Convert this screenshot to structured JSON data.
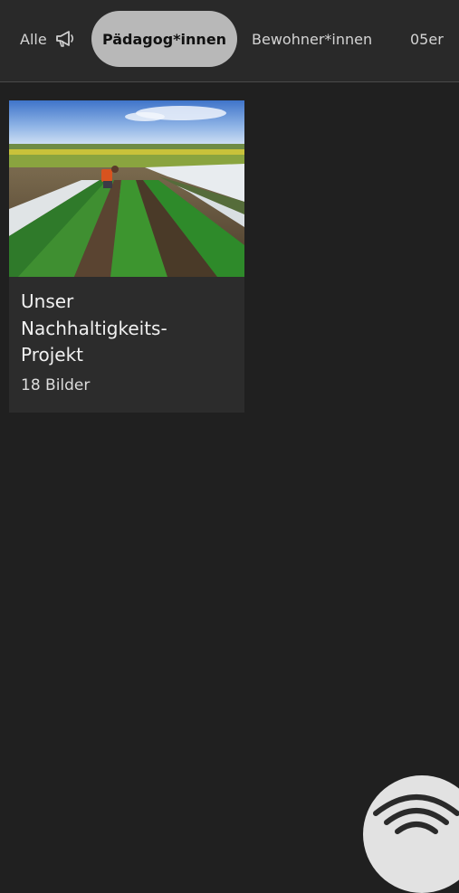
{
  "tabs": {
    "all_label": "Alle",
    "all_icon": "megaphone-icon",
    "active_label": "Pädagog*innen",
    "bewohner_label": "Bewohner*innen",
    "partial_label": "05er"
  },
  "albums": [
    {
      "title": "Unser Nachhaltigkeits-Projekt",
      "count": "18 Bilder",
      "thumbnail": "vegetable-field-photo"
    }
  ],
  "fab": {
    "icon": "wifi-signal-icon"
  },
  "colors": {
    "background": "#202020",
    "tabbar": "#292929",
    "active_tab": "#b8b8b8",
    "card": "#2c2c2c"
  }
}
